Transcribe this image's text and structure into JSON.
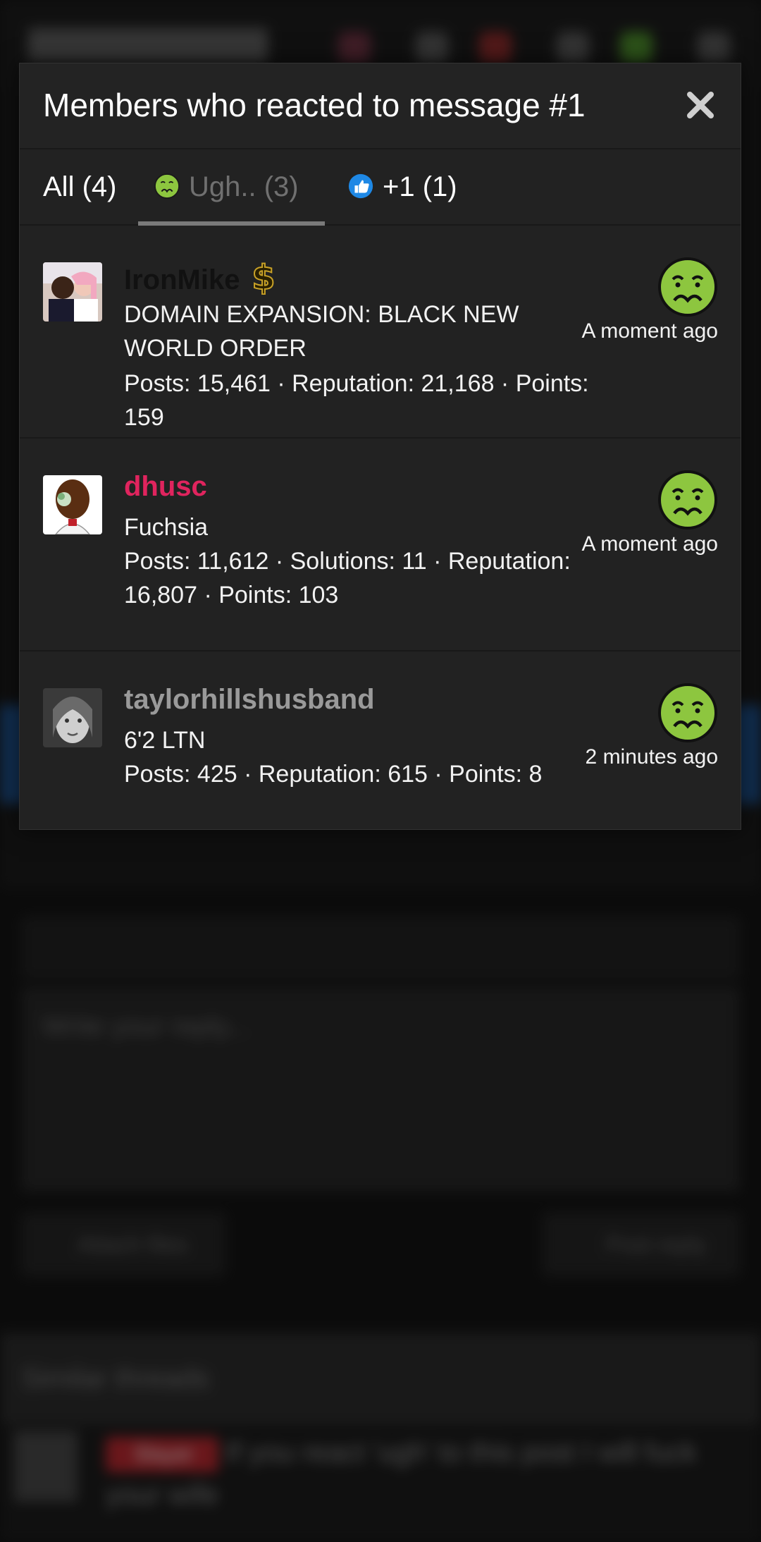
{
  "background": {
    "editor_placeholder": "Write your reply...",
    "attach_label": "Attach files",
    "post_reply_label": "Post reply",
    "similar_heading": "Similar threads",
    "thread_badge": "Slayer",
    "thread_title": "If you react 'ugh' to this post I will fuck your wife"
  },
  "modal": {
    "title": "Members who reacted to message #1",
    "tabs": [
      {
        "label": "All (4)"
      },
      {
        "label": "Ugh.. (3)",
        "icon": "nauseated-face-icon"
      },
      {
        "label": "+1 (1)",
        "icon": "thumbs-up-icon"
      }
    ],
    "members": [
      {
        "username": "IronMike",
        "username_color": "#111111",
        "title": "DOMAIN EXPANSION: BLACK NEW WORLD ORDER",
        "stats": "Posts: 15,461 · Reputation: 21,168 · Points: 159",
        "reaction_icon": "nauseated-face-icon",
        "time": "A moment ago"
      },
      {
        "username": "dhusc",
        "username_color": "#e0245e",
        "title": "Fuchsia",
        "stats": "Posts: 11,612 · Solutions: 11 · Reputation: 16,807 · Points: 103",
        "reaction_icon": "nauseated-face-icon",
        "time": "A moment ago"
      },
      {
        "username": "taylorhillshusband",
        "username_color": "#9a9a9a",
        "title": "6'2 LTN",
        "stats": "Posts: 425 · Reputation: 615 · Points: 8",
        "reaction_icon": "nauseated-face-icon",
        "time": "2 minutes ago"
      }
    ]
  },
  "colors": {
    "modal_bg": "#222222",
    "reaction_green": "#8dc63f",
    "thumbs_blue": "#1e88e5",
    "dollar_gold": "#c9a227"
  }
}
